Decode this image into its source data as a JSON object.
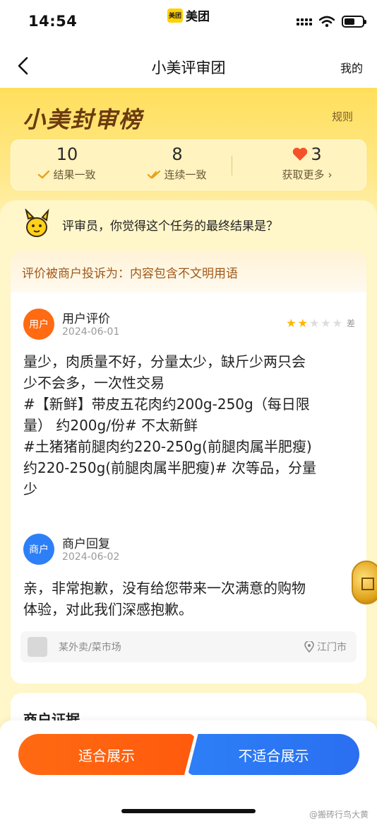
{
  "status_bar": {
    "time": "14:54",
    "app_name": "美团",
    "app_logo_text": "美团",
    "battery_level": 0.6
  },
  "navbar": {
    "back_icon": "chevron-left-icon",
    "title": "小美评审团",
    "mine": "我的"
  },
  "header": {
    "title": "小美封审榜",
    "rules": "规则",
    "stats": [
      {
        "value": "10",
        "label": "结果一致",
        "icon": "check-icon"
      },
      {
        "value": "8",
        "label": "连续一致",
        "icon": "double-check-icon"
      },
      {
        "value": "3",
        "label": "获取更多",
        "icon": "heart-icon",
        "chevron": "›"
      }
    ]
  },
  "prompt": {
    "text": "评审员，你觉得这个任务的最终结果是？"
  },
  "review": {
    "complaint": "评价被商户投诉为：内容包含不文明用语",
    "user": {
      "avatar": "用户",
      "name": "用户评价",
      "date": "2024-06-01",
      "rating": 2,
      "rating_max": 5,
      "rating_label": "差",
      "lines": [
        "量少，肉质量不好，分量太少，缺斤少两只会",
        "少不会多，一次性交易",
        "#【新鲜】带皮五花肉约200g-250g（每日限",
        "量） 约200g/份# 不太新鲜",
        "#土猪猪前腿肉约220-250g(前腿肉属半肥瘦)",
        "约220-250g(前腿肉属半肥瘦)# 次等品，分量",
        "少"
      ]
    },
    "merchant": {
      "avatar": "商户",
      "name": "商户回复",
      "date": "2024-06-02",
      "lines": [
        "亲，非常抱歉，没有给您带来一次满意的购物",
        "体验，对此我们深感抱歉。"
      ]
    },
    "shop": {
      "name": "某外卖/菜市场",
      "location": "江门市"
    }
  },
  "evidence": {
    "title": "商户证据"
  },
  "actions": {
    "suitable": "适合展示",
    "unsuitable": "不适合展示"
  },
  "watermark": "@搬砖行鸟大黄",
  "colors": {
    "accent_orange": "#ff6a12",
    "accent_blue": "#2d7ff7",
    "header_yellow": "#ffdf5c",
    "star_filled": "#ffb400",
    "star_empty": "#dddddd"
  }
}
